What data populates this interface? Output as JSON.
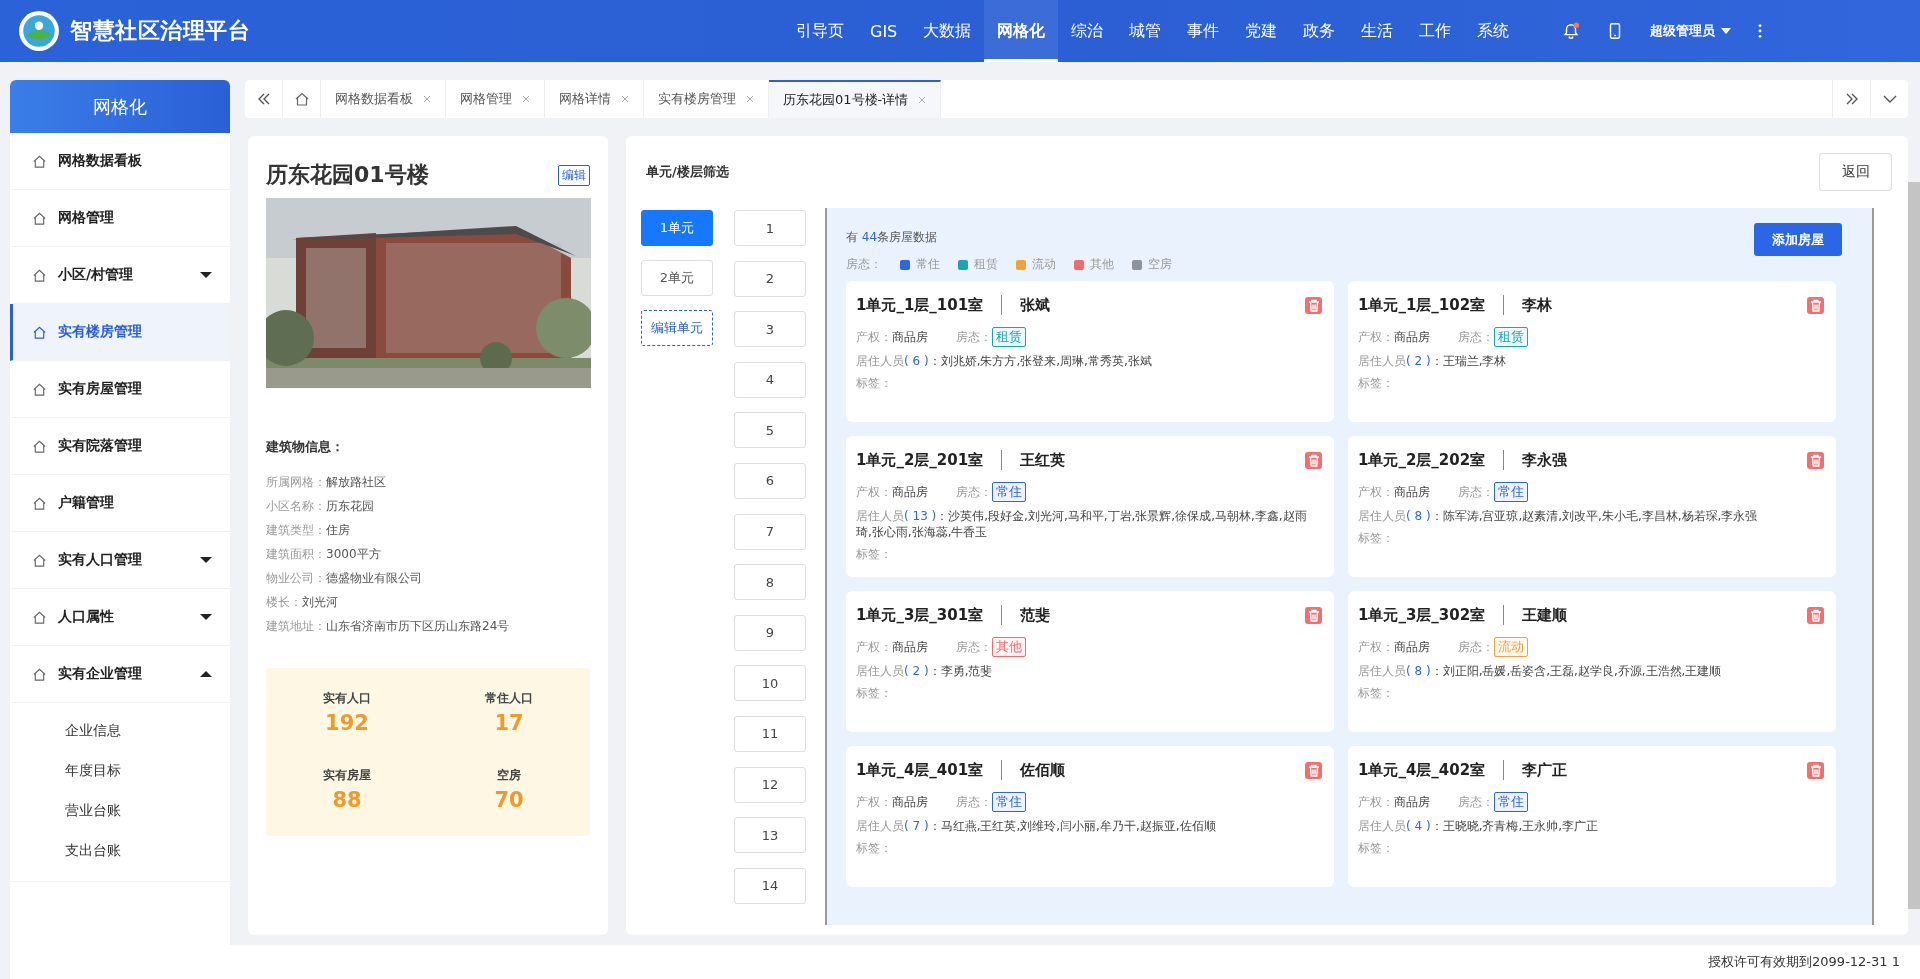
{
  "header": {
    "title": "智慧社区治理平台",
    "nav": [
      {
        "label": "引导页",
        "selected": false
      },
      {
        "label": "GIS",
        "selected": false
      },
      {
        "label": "大数据",
        "selected": false
      },
      {
        "label": "网格化",
        "selected": true
      },
      {
        "label": "综治",
        "selected": false
      },
      {
        "label": "城管",
        "selected": false
      },
      {
        "label": "事件",
        "selected": false
      },
      {
        "label": "党建",
        "selected": false
      },
      {
        "label": "政务",
        "selected": false
      },
      {
        "label": "生活",
        "selected": false
      },
      {
        "label": "工作",
        "selected": false
      },
      {
        "label": "系统",
        "selected": false
      }
    ],
    "notification_unread": true,
    "user": "超级管理员"
  },
  "sidebar": {
    "title": "网格化",
    "items": [
      {
        "label": "网格数据看板",
        "selected": false
      },
      {
        "label": "网格管理",
        "selected": false
      },
      {
        "label": "小区/村管理",
        "selected": false,
        "expanded": false
      },
      {
        "label": "实有楼房管理",
        "selected": true
      },
      {
        "label": "实有房屋管理",
        "selected": false
      },
      {
        "label": "实有院落管理",
        "selected": false
      },
      {
        "label": "户籍管理",
        "selected": false
      },
      {
        "label": "实有人口管理",
        "selected": false,
        "expanded": false
      },
      {
        "label": "人口属性",
        "selected": false,
        "expanded": false
      },
      {
        "label": "实有企业管理",
        "selected": false,
        "expanded": true,
        "children": [
          {
            "label": "企业信息"
          },
          {
            "label": "年度目标"
          },
          {
            "label": "营业台账"
          },
          {
            "label": "支出台账"
          }
        ]
      }
    ]
  },
  "tabs": [
    {
      "label": "网格数据看板",
      "selected": false
    },
    {
      "label": "网格管理",
      "selected": false
    },
    {
      "label": "网格详情",
      "selected": false
    },
    {
      "label": "实有楼房管理",
      "selected": false
    },
    {
      "label": "历东花园01号楼-详情",
      "selected": true
    }
  ],
  "building": {
    "name": "历东花园01号楼",
    "edit_button": "编辑",
    "info_heading": "建筑物信息：",
    "info": [
      {
        "label": "所属网格：",
        "value": "解放路社区"
      },
      {
        "label": "小区名称：",
        "value": "历东花园"
      },
      {
        "label": "建筑类型：",
        "value": "住房"
      },
      {
        "label": "建筑面积：",
        "value": "3000平方"
      },
      {
        "label": "物业公司：",
        "value": "德盛物业有限公司"
      },
      {
        "label": "楼长：",
        "value": "刘光河"
      },
      {
        "label": "建筑地址：",
        "value": "山东省济南市历下区历山东路24号"
      }
    ],
    "stats": [
      {
        "label": "实有人口",
        "value": "192"
      },
      {
        "label": "常住人口",
        "value": "17"
      },
      {
        "label": "实有房屋",
        "value": "88"
      },
      {
        "label": "空房",
        "value": "70"
      }
    ]
  },
  "filter": {
    "heading": "单元/楼层筛选",
    "back_button": "返回",
    "units": [
      {
        "label": "1单元",
        "selected": true
      },
      {
        "label": "2单元",
        "selected": false
      }
    ],
    "edit_units": "编辑单元",
    "floors": [
      "1",
      "2",
      "3",
      "4",
      "5",
      "6",
      "7",
      "8",
      "9",
      "10",
      "11",
      "12",
      "13",
      "14"
    ]
  },
  "listing": {
    "count_prefix": "有",
    "count": "44",
    "count_suffix": "条房屋数据",
    "add_button": "添加房屋",
    "legend_label": "房态：",
    "legend": [
      {
        "label": "常住",
        "color": "#2f66e0"
      },
      {
        "label": "租赁",
        "color": "#1ea2b4"
      },
      {
        "label": "流动",
        "color": "#f0a33a"
      },
      {
        "label": "其他",
        "color": "#f06b6b"
      },
      {
        "label": "空房",
        "color": "#8e939b"
      }
    ],
    "rooms": [
      {
        "room": "1单元_1层_101室",
        "owner": "张斌",
        "property_label": "产权：",
        "property": "商品房",
        "status_label": "房态：",
        "status": "租赁",
        "color": "#1ea2b4",
        "residents_label": "居住人员",
        "residents_count": "( 6 )",
        "residents": "：刘兆娇,朱方方,张登来,周琳,常秀英,张斌",
        "tags_label": "标签："
      },
      {
        "room": "1单元_1层_102室",
        "owner": "李林",
        "property_label": "产权：",
        "property": "商品房",
        "status_label": "房态：",
        "status": "租赁",
        "color": "#1ea2b4",
        "residents_label": "居住人员",
        "residents_count": "( 2 )",
        "residents": "：王瑞兰,李林",
        "tags_label": "标签："
      },
      {
        "room": "1单元_2层_201室",
        "owner": "王红英",
        "property_label": "产权：",
        "property": "商品房",
        "status_label": "房态：",
        "status": "常住",
        "color": "#2f66e0",
        "residents_label": "居住人员",
        "residents_count": "( 13 )",
        "residents": "：沙英伟,段好金,刘光河,马和平,丁岩,张景辉,徐保成,马朝林,李鑫,赵雨琦,张心雨,张海蕊,牛香玉",
        "tags_label": "标签："
      },
      {
        "room": "1单元_2层_202室",
        "owner": "李永强",
        "property_label": "产权：",
        "property": "商品房",
        "status_label": "房态：",
        "status": "常住",
        "color": "#2f66e0",
        "residents_label": "居住人员",
        "residents_count": "( 8 )",
        "residents": "：陈军涛,宫亚琼,赵素清,刘改平,朱小毛,李昌林,杨若琛,李永强",
        "tags_label": "标签："
      },
      {
        "room": "1单元_3层_301室",
        "owner": "范斐",
        "property_label": "产权：",
        "property": "商品房",
        "status_label": "房态：",
        "status": "其他",
        "color": "#f06b6b",
        "residents_label": "居住人员",
        "residents_count": "( 2 )",
        "residents": "：李勇,范斐",
        "tags_label": "标签："
      },
      {
        "room": "1单元_3层_302室",
        "owner": "王建顺",
        "property_label": "产权：",
        "property": "商品房",
        "status_label": "房态：",
        "status": "流动",
        "color": "#f0a33a",
        "residents_label": "居住人员",
        "residents_count": "( 8 )",
        "residents": "：刘正阳,岳媛,岳姿含,王磊,赵学良,乔源,王浩然,王建顺",
        "tags_label": "标签："
      },
      {
        "room": "1单元_4层_401室",
        "owner": "佐佰顺",
        "property_label": "产权：",
        "property": "商品房",
        "status_label": "房态：",
        "status": "常住",
        "color": "#2f66e0",
        "residents_label": "居住人员",
        "residents_count": "( 7 )",
        "residents": "：马红燕,王红英,刘维玲,闫小丽,牟乃干,赵振亚,佐佰顺",
        "tags_label": "标签："
      },
      {
        "room": "1单元_4层_402室",
        "owner": "李广正",
        "property_label": "产权：",
        "property": "商品房",
        "status_label": "房态：",
        "status": "常住",
        "color": "#2f66e0",
        "residents_label": "居住人员",
        "residents_count": "( 4 )",
        "residents": "：王晓晓,齐青梅,王永帅,李广正",
        "tags_label": "标签："
      }
    ]
  },
  "footer": "授权许可有效期到2099-12-31 1"
}
